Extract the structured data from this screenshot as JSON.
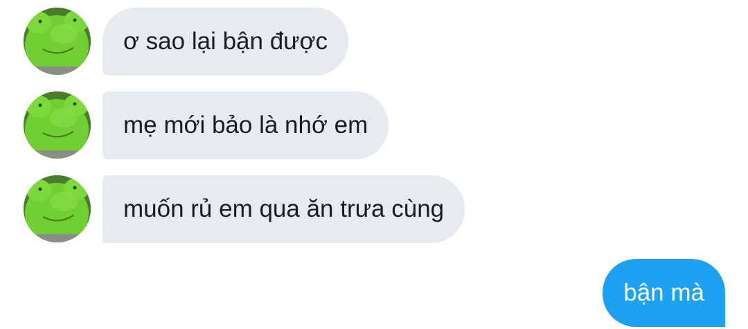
{
  "conversation": {
    "messages": [
      {
        "sender": "contact",
        "text": "ơ sao lại bận được",
        "avatar_icon": "frog-plush-avatar-icon"
      },
      {
        "sender": "contact",
        "text": "mẹ mới bảo là nhớ em",
        "avatar_icon": "frog-plush-avatar-icon"
      },
      {
        "sender": "contact",
        "text": "muốn rủ em qua ăn trưa cùng",
        "avatar_icon": "frog-plush-avatar-icon"
      },
      {
        "sender": "me",
        "text": "bận mà"
      }
    ]
  },
  "colors": {
    "incoming_bubble": "#e6ebf0",
    "outgoing_bubble": "#1da1f2",
    "incoming_text": "#1c1c1c",
    "outgoing_text": "#ffffff",
    "avatar_green": "#6ccc2f"
  }
}
